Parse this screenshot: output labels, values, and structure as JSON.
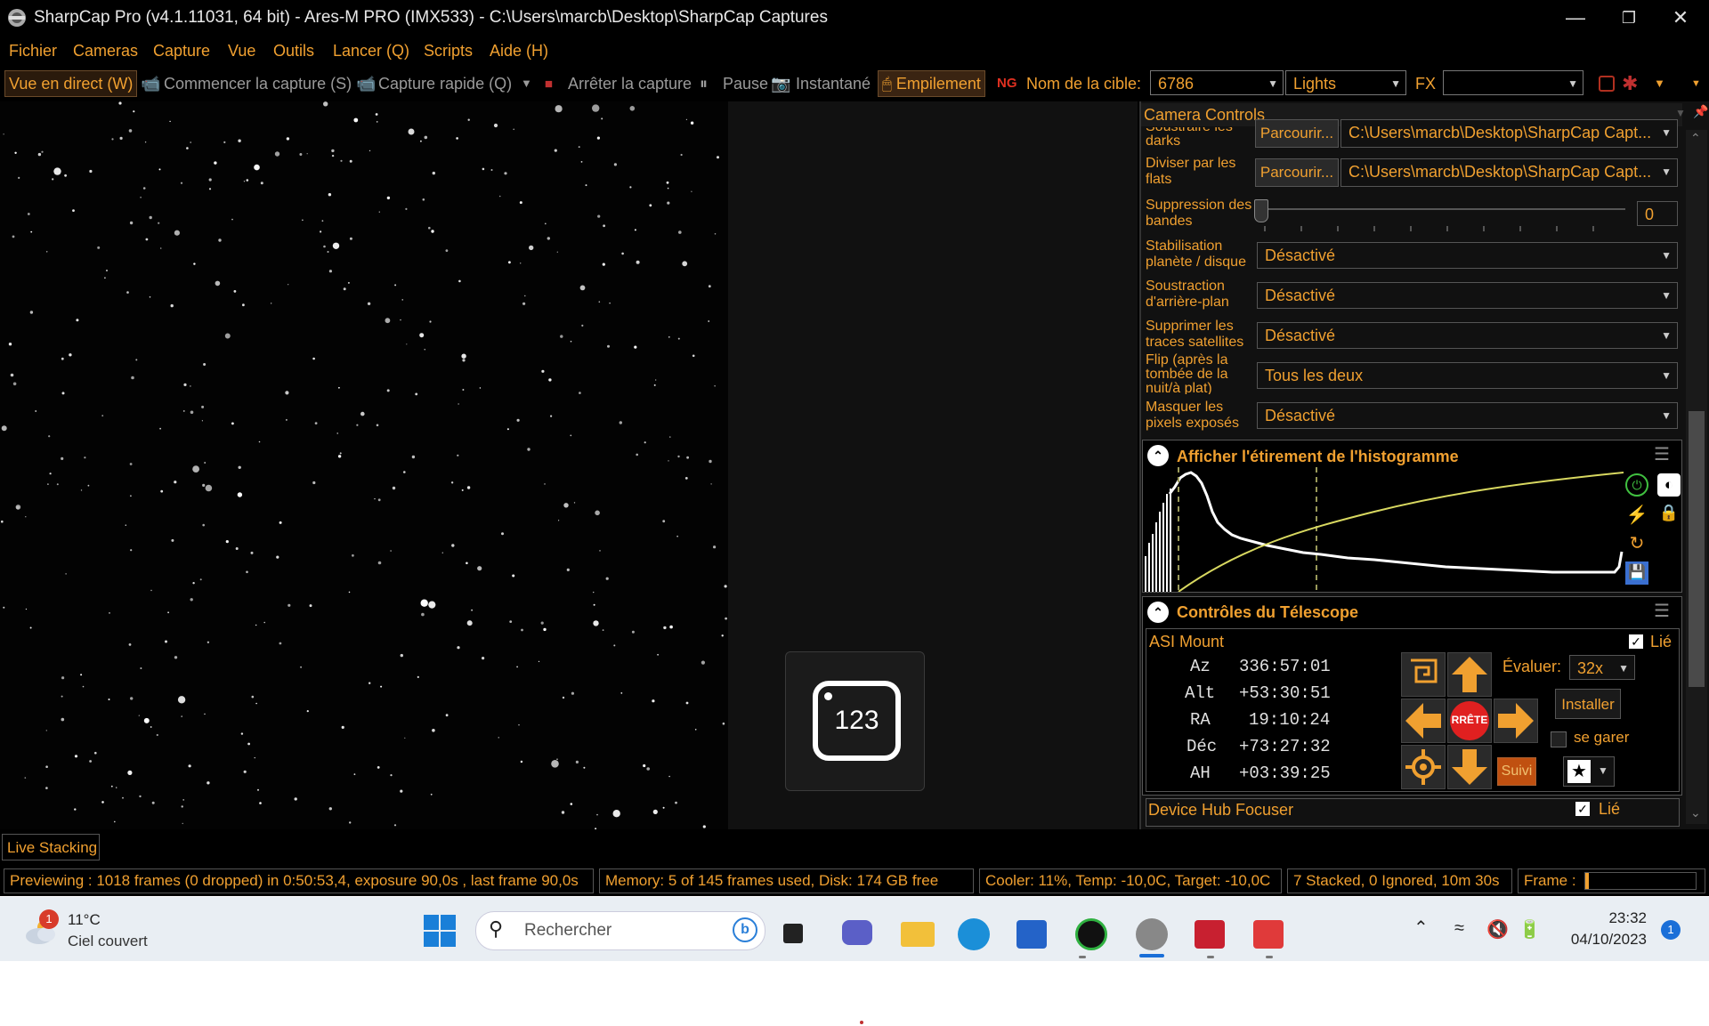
{
  "titlebar": {
    "title": "SharpCap Pro (v4.1.11031, 64 bit) - Ares-M PRO (IMX533) - C:\\Users\\marcb\\Desktop\\SharpCap Captures"
  },
  "menu": [
    "Fichier",
    "Cameras",
    "Capture",
    "Vue",
    "Outils",
    "Lancer (Q)",
    "Scripts",
    "Aide (H)"
  ],
  "toolbar": {
    "live_view": "Vue en direct (W)",
    "start_capture": "Commencer la capture (S)",
    "quick_capture": "Capture rapide (Q)",
    "stop_capture": "Arrêter la capture",
    "pause": "Pause",
    "snapshot": "Instantané",
    "stacking": "Empilement",
    "target_label": "Nom de la cible:",
    "target_value": "6786",
    "frame_type": "Lights",
    "fx_label": "FX",
    "fx_value": ""
  },
  "camera_controls": {
    "header": "Camera Controls",
    "rows": [
      {
        "label": "Soustraire les darks",
        "button": "Parcourir...",
        "value": "C:\\Users\\marcb\\Desktop\\SharpCap Capt..."
      },
      {
        "label": "Diviser par les flats",
        "button": "Parcourir...",
        "value": "C:\\Users\\marcb\\Desktop\\SharpCap Capt..."
      }
    ],
    "banding": {
      "label": "Suppression des bandes",
      "value": "0"
    },
    "dropdowns": [
      {
        "label": "Stabilisation planète / disque",
        "value": "Désactivé"
      },
      {
        "label": "Soustraction d'arrière-plan",
        "value": "Désactivé"
      },
      {
        "label": "Supprimer les traces satellites",
        "value": "Désactivé"
      },
      {
        "label": "Flip (après la tombée de la nuit/à plat)",
        "value": "Tous les deux"
      },
      {
        "label": "Masquer les pixels exposés",
        "value": "Désactivé"
      }
    ]
  },
  "histogram": {
    "title": "Afficher l'étirement de l'histogramme"
  },
  "telescope": {
    "title": "Contrôles du Télescope",
    "mount_name": "ASI Mount",
    "linked_label": "Lié",
    "coords": [
      {
        "label": "Az",
        "value": "336:57:01"
      },
      {
        "label": "Alt",
        "value": "+53:30:51"
      },
      {
        "label": "RA",
        "value": "19:10:24"
      },
      {
        "label": "Déc",
        "value": "+73:27:32"
      },
      {
        "label": "AH",
        "value": "+03:39:25"
      }
    ],
    "rate_label": "Évaluer:",
    "rate_value": "32x",
    "stop_label": "RRÊTE",
    "install_label": "Installer",
    "park_label": "se garer",
    "tracking_label": "Suivi"
  },
  "focuser": {
    "name": "Device Hub Focuser",
    "linked_label": "Lié"
  },
  "notification": {
    "value": "123"
  },
  "live_stacking_tab": "Live Stacking",
  "status": {
    "preview": "Previewing : 1018 frames (0 dropped) in 0:50:53,4, exposure 90,0s , last frame 90,0s",
    "memory": "Memory: 5 of 145 frames used, Disk: 174 GB free",
    "cooler": "Cooler: 11%, Temp: -10,0C, Target: -10,0C",
    "stacked": "7 Stacked, 0 Ignored, 10m 30s",
    "frame_label": "Frame :",
    "frame_progress": 0.03
  },
  "taskbar": {
    "weather_temp": "11°C",
    "weather_desc": "Ciel couvert",
    "weather_badge": "1",
    "search_placeholder": "Rechercher",
    "time": "23:32",
    "date": "04/10/2023",
    "notif_count": "1"
  },
  "colors": {
    "accent": "#f0a030",
    "background": "#000000",
    "stop": "#e02020",
    "taskbar": "#e9eef3"
  }
}
